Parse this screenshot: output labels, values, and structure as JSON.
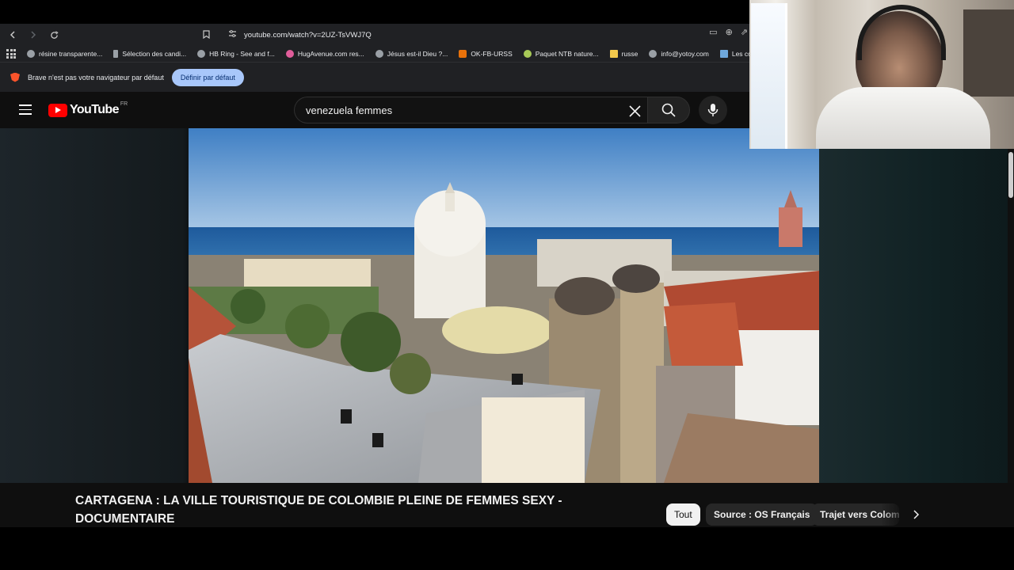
{
  "browser": {
    "url": "youtube.com/watch?v=2UZ-TsVWJ7Q",
    "bookmarks": [
      {
        "label": "résine transparente...",
        "color": "#9aa0a6"
      },
      {
        "label": "Sélection des candi...",
        "color": "#9aa0a6"
      },
      {
        "label": "HB Ring - See and f...",
        "color": "#9aa0a6"
      },
      {
        "label": "HugAvenue.com res...",
        "color": "#e05d9a"
      },
      {
        "label": "Jésus est-il Dieu ?...",
        "color": "#9aa0a6"
      },
      {
        "label": "OK-FB-URSS",
        "color": "#e8710a"
      },
      {
        "label": "Paquet NTB nature...",
        "color": "#a7c957"
      },
      {
        "label": "russe",
        "color": "#f2c94c"
      },
      {
        "label": "info@yotoy.com",
        "color": "#9aa0a6"
      },
      {
        "label": "Les concours d'aute...",
        "color": "#6fa8dc"
      }
    ],
    "infobar": {
      "text": "Brave n'est pas votre navigateur par défaut",
      "button": "Définir par défaut"
    }
  },
  "youtube": {
    "logo_text": "YouTube",
    "country_code": "FR",
    "search_query": "venezuela femmes",
    "video_title": "CARTAGENA : LA VILLE TOURISTIQUE DE COLOMBIE PLEINE DE FEMMES SEXY - DOCUMENTAIRE",
    "chips": [
      "Tout",
      "Source : OS Français",
      "Trajet vers Colombie"
    ]
  }
}
